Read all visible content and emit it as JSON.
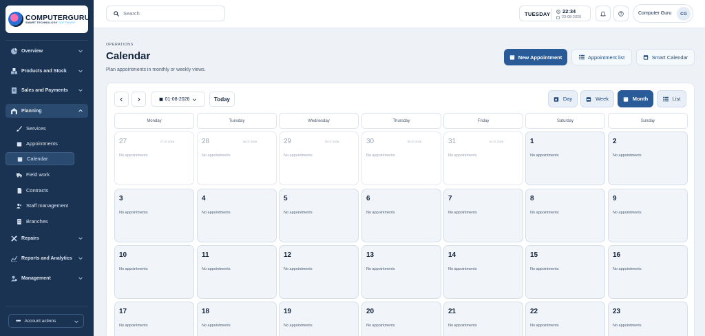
{
  "brand": {
    "name": "COMPUTERGURU",
    "tagline_main": "SMART TECHNOLOGY",
    "tagline_accent": "SOFTWARE"
  },
  "sidebar": {
    "items": [
      {
        "label": "Overview",
        "icon": "pie-chart-icon"
      },
      {
        "label": "Products and Stock",
        "icon": "boxes-icon"
      },
      {
        "label": "Sales and Payments",
        "icon": "receipt-icon"
      },
      {
        "label": "Planning",
        "icon": "warehouse-icon"
      },
      {
        "label": "Repairs",
        "icon": "tools-icon"
      },
      {
        "label": "Reports and Analytics",
        "icon": "trend-chart-icon"
      },
      {
        "label": "Management",
        "icon": "user-gear-icon"
      }
    ],
    "planning_sub": [
      {
        "label": "Services",
        "icon": "brush-icon"
      },
      {
        "label": "Appointments",
        "icon": "calendar-icon"
      },
      {
        "label": "Calendar",
        "icon": "calendar-icon"
      },
      {
        "label": "Field work",
        "icon": "truck-icon"
      },
      {
        "label": "Contracts",
        "icon": "document-icon"
      },
      {
        "label": "Staff management",
        "icon": "users-icon"
      },
      {
        "label": "Branches",
        "icon": "building-icon"
      }
    ],
    "account_actions": "Account actions"
  },
  "topbar": {
    "search_placeholder": "Search",
    "day": "TUESDAY",
    "time": "22:34",
    "date": "23-08-2026",
    "user_name": "Computer Guru",
    "user_initials": "CG"
  },
  "header": {
    "section": "OPERATIONS",
    "title": "Calendar",
    "description": "Plan appointments in monthly or weekly views.",
    "new_appointment": "New Appointment",
    "appointment_list": "Appointment list",
    "smart_calendar": "Smart Calendar"
  },
  "calendar": {
    "current_date": "01-08-2026",
    "today": "Today",
    "views": [
      "Day",
      "Week",
      "Month",
      "List"
    ],
    "active_view": "Month",
    "weekdays": [
      "Monday",
      "Tuesday",
      "Wednesday",
      "Thursday",
      "Friday",
      "Saturday",
      "Sunday"
    ],
    "no_appointments": "No appointments",
    "cells": [
      {
        "day": "27",
        "date": "27-07-2026",
        "muted": true
      },
      {
        "day": "28",
        "date": "28-07-2026",
        "muted": true
      },
      {
        "day": "29",
        "date": "29-07-2026",
        "muted": true
      },
      {
        "day": "30",
        "date": "30-07-2026",
        "muted": true
      },
      {
        "day": "31",
        "date": "31-07-2026",
        "muted": true
      },
      {
        "day": "1",
        "date": "",
        "muted": false
      },
      {
        "day": "2",
        "date": "",
        "muted": false
      },
      {
        "day": "3",
        "date": "",
        "muted": false
      },
      {
        "day": "4",
        "date": "",
        "muted": false
      },
      {
        "day": "5",
        "date": "",
        "muted": false
      },
      {
        "day": "6",
        "date": "",
        "muted": false
      },
      {
        "day": "7",
        "date": "",
        "muted": false
      },
      {
        "day": "8",
        "date": "",
        "muted": false
      },
      {
        "day": "9",
        "date": "",
        "muted": false
      },
      {
        "day": "10",
        "date": "",
        "muted": false
      },
      {
        "day": "11",
        "date": "",
        "muted": false
      },
      {
        "day": "12",
        "date": "",
        "muted": false
      },
      {
        "day": "13",
        "date": "",
        "muted": false
      },
      {
        "day": "14",
        "date": "",
        "muted": false
      },
      {
        "day": "15",
        "date": "",
        "muted": false
      },
      {
        "day": "16",
        "date": "",
        "muted": false
      },
      {
        "day": "17",
        "date": "",
        "muted": false
      },
      {
        "day": "18",
        "date": "",
        "muted": false
      },
      {
        "day": "19",
        "date": "",
        "muted": false
      },
      {
        "day": "20",
        "date": "",
        "muted": false
      },
      {
        "day": "21",
        "date": "",
        "muted": false
      },
      {
        "day": "22",
        "date": "",
        "muted": false
      },
      {
        "day": "23",
        "date": "",
        "muted": false
      }
    ]
  },
  "colors": {
    "sidebar": "#1b3352",
    "primary": "#2a5b99",
    "background": "#eef2f7"
  }
}
